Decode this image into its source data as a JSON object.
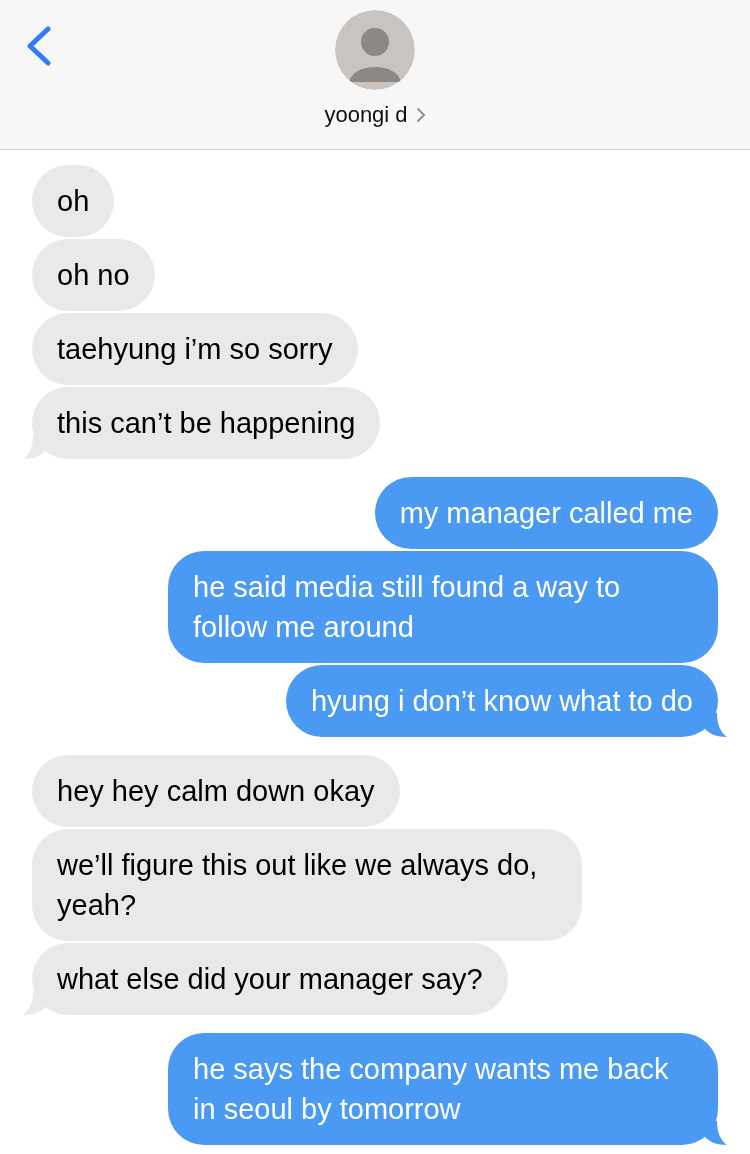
{
  "header": {
    "contact_name": "yoongi d"
  },
  "messages": [
    {
      "kind": "received",
      "text": "oh",
      "tail": false
    },
    {
      "kind": "received",
      "text": "oh no",
      "tail": false
    },
    {
      "kind": "received",
      "text": "taehyung i’m so sorry",
      "tail": false
    },
    {
      "kind": "received",
      "text": "this can’t be happening",
      "tail": true
    },
    {
      "kind": "sent",
      "text": "my manager called me",
      "tail": false
    },
    {
      "kind": "sent",
      "text": "he said media still found a way to follow me around",
      "tail": false
    },
    {
      "kind": "sent",
      "text": "hyung i don’t know what to do",
      "tail": true
    },
    {
      "kind": "received",
      "text": "hey hey calm down okay",
      "tail": false
    },
    {
      "kind": "received",
      "text": "we’ll figure this out like we always do, yeah?",
      "tail": false
    },
    {
      "kind": "received",
      "text": "what else did your manager say?",
      "tail": true
    },
    {
      "kind": "sent",
      "text": "he says the company wants me back in seoul by tomorrow",
      "tail": true
    }
  ]
}
